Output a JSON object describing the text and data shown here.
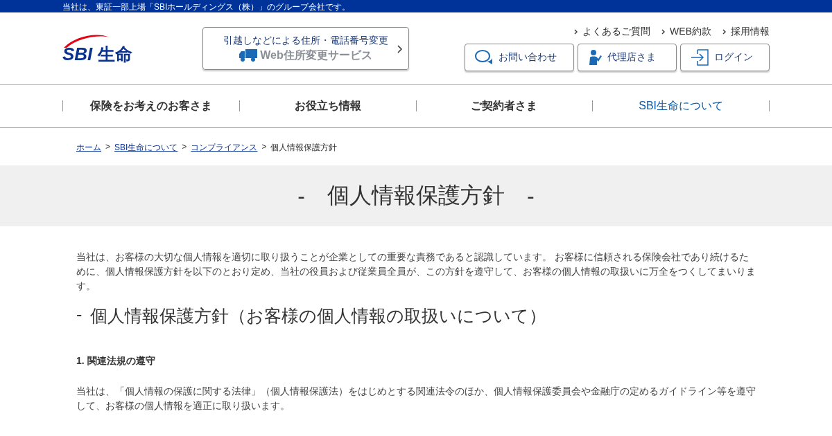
{
  "top_bar": {
    "text": "当社は、東証一部上場「SBIホールディングス（株）」のグループ会社です。"
  },
  "logo": {
    "latin": "SBI",
    "kanji": "生命"
  },
  "address_banner": {
    "line1": "引越しなどによる住所・電話番号変更",
    "line2": "Web住所変更サービス"
  },
  "utility_links": [
    "よくあるご質問",
    "WEB約款",
    "採用情報"
  ],
  "header_buttons": [
    {
      "kind": "chat",
      "label": "お問い合わせ"
    },
    {
      "kind": "agent",
      "label": "代理店さま"
    },
    {
      "kind": "login",
      "label": "ログイン"
    }
  ],
  "nav": [
    {
      "label": "保険をお考えのお客さま",
      "selected": false
    },
    {
      "label": "お役立ち情報",
      "selected": false
    },
    {
      "label": "ご契約者さま",
      "selected": false
    },
    {
      "label": "SBI生命について",
      "selected": true
    }
  ],
  "breadcrumb": {
    "links": [
      "ホーム",
      "SBI生命について",
      "コンプライアンス"
    ],
    "separators": [
      ">",
      ">",
      ">"
    ],
    "current": "個人情報保護方針"
  },
  "page_title": {
    "dash_left": "-",
    "text": "個人情報保護方針",
    "dash_right": "-"
  },
  "intro": "当社は、お客様の大切な個人情報を適切に取り扱うことが企業としての重要な責務であると認識しています。 お客様に信頼される保険会社であり続けるために、個人情報保護方針を以下のとおり定め、当社の役員および従業員全員が、この方針を遵守して、お客様の個人情報の取扱いに万全をつくしてまいります。",
  "section_heading": {
    "dash": "-",
    "text": "個人情報保護方針（お客様の個人情報の取扱いについて）"
  },
  "clauses": [
    {
      "title": "1. 関連法規の遵守",
      "body": "当社は、「個人情報の保護に関する法律」（個人情報保護法）をはじめとする関連法令のほか、個人情報保護委員会や金融庁の定めるガイドライン等を遵守して、お客様の個人情報を適正に取り扱います。"
    }
  ]
}
